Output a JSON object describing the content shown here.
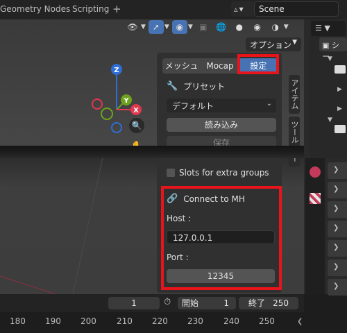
{
  "topbar": {
    "workspaces": [
      "Geometry Nodes",
      "Scripting"
    ],
    "add_label": "+",
    "scene_name": "Scene"
  },
  "viewport": {
    "option_label": "オプション",
    "gizmo": {
      "z": "Z",
      "y": "Y",
      "x": "X"
    }
  },
  "panel": {
    "tabs": [
      "メッシュ",
      "Mocap",
      "設定"
    ],
    "active_tab": "設定",
    "preset_header": "プリセット",
    "preset_value": "デフォルト",
    "load_label": "読み込み",
    "save_label": "保存",
    "slots_label": "Slots for extra groups"
  },
  "connect": {
    "title": "Connect to MH",
    "host_label": "Host :",
    "host_value": "127.0.0.1",
    "port_label": "Port :",
    "port_value": "12345"
  },
  "side_tabs": [
    "アイテム",
    "ツール",
    "ー"
  ],
  "outliner": {
    "truncated_label": "シー"
  },
  "timeline": {
    "current_frame": "1",
    "start_label": "開始",
    "start_value": "1",
    "end_label": "終了",
    "end_value": "250"
  },
  "ruler": [
    "180",
    "190",
    "200",
    "210",
    "220",
    "230",
    "240",
    "250"
  ],
  "colors": {
    "accent": "#4772b3",
    "highlight": "#e8141c",
    "x_axis": "#e0384e",
    "y_axis": "#6ea21e",
    "z_axis": "#2f6ed6"
  }
}
